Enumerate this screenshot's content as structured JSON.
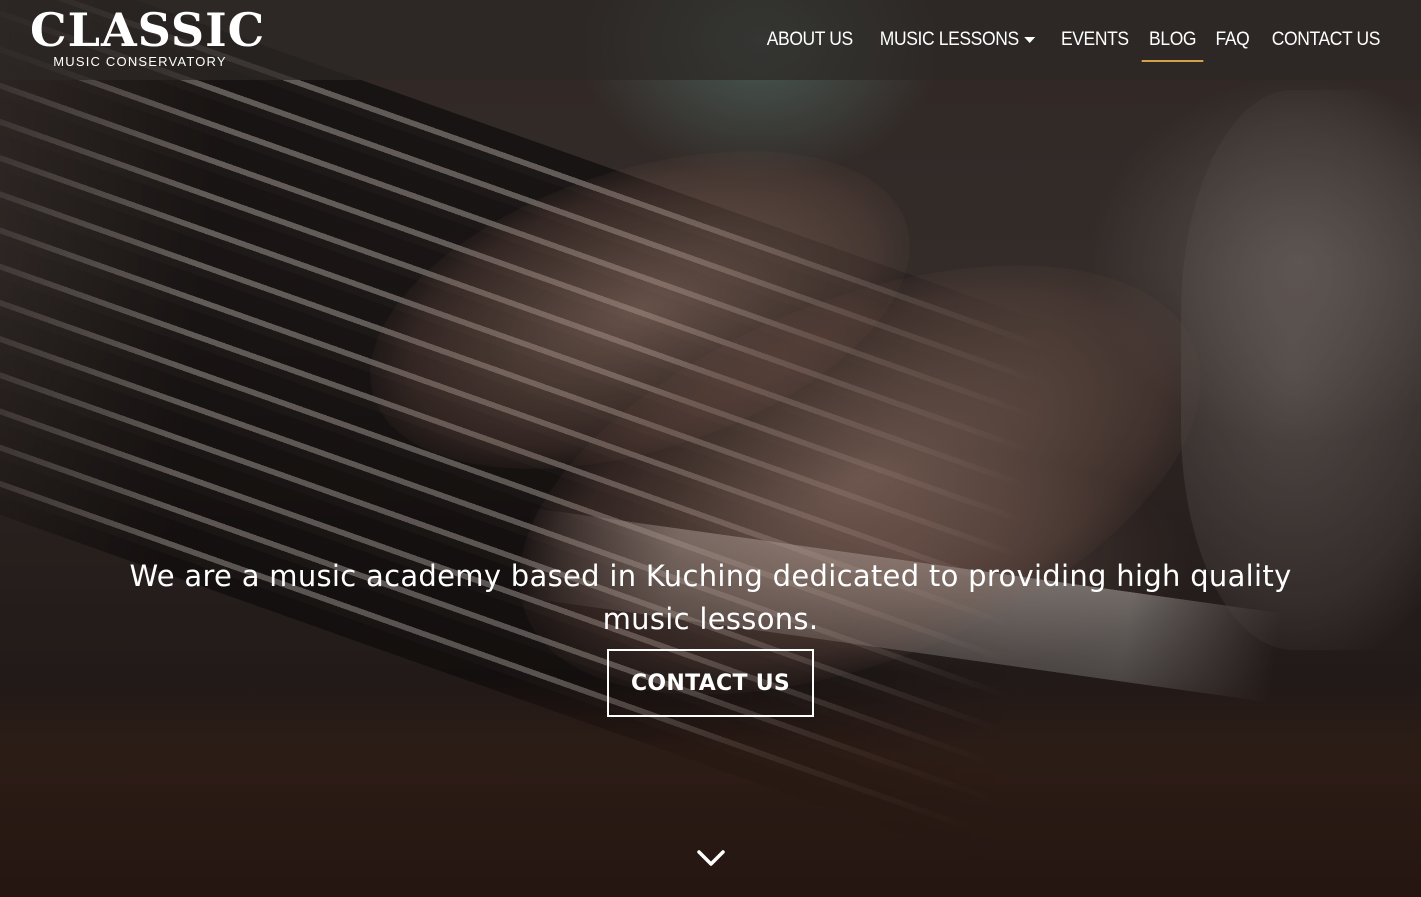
{
  "brand": {
    "name": "CLASSIC",
    "subtitle": "MUSIC CONSERVATORY"
  },
  "nav": {
    "items": [
      {
        "label": "ABOUT US",
        "has_dropdown": false,
        "active": false
      },
      {
        "label": "MUSIC LESSONS",
        "has_dropdown": true,
        "active": false
      },
      {
        "label": "EVENTS",
        "has_dropdown": false,
        "active": false
      },
      {
        "label": "BLOG",
        "has_dropdown": false,
        "active": true
      },
      {
        "label": "FAQ",
        "has_dropdown": false,
        "active": false
      },
      {
        "label": "CONTACT US",
        "has_dropdown": false,
        "active": false
      }
    ],
    "active_indicator_color": "#d4a24a"
  },
  "hero": {
    "tagline": "We are a music academy based in Kuching dedicated to providing high quality music lessons.",
    "cta_label": "CONTACT US",
    "scroll_icon": "chevron-down-icon"
  },
  "colors": {
    "header_bg": "#2d2826",
    "text": "#ffffff",
    "accent": "#d4a24a"
  }
}
